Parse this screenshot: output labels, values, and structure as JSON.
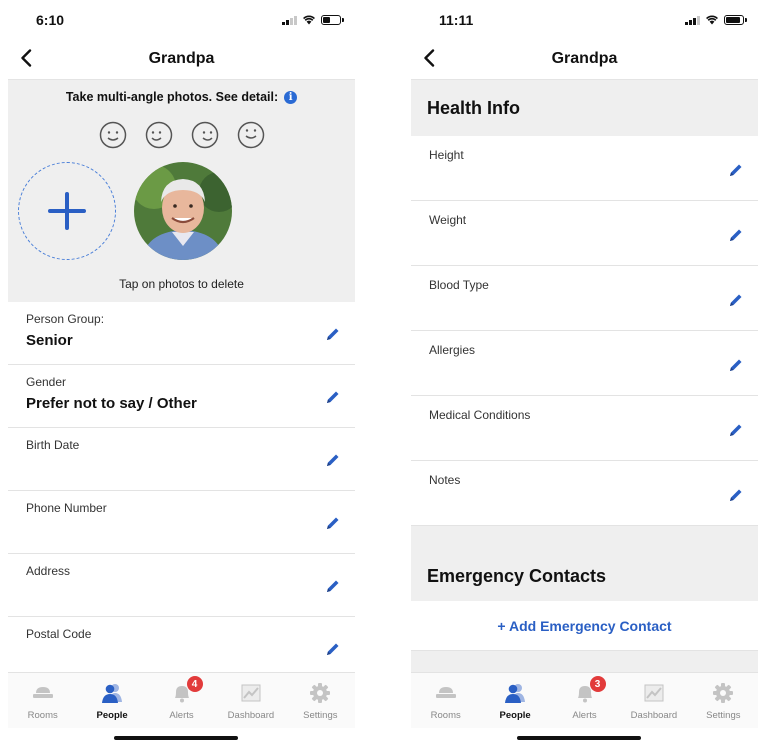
{
  "colors": {
    "accent": "#2a5fc4",
    "section_bg": "#efefef",
    "badge": "#e23b3b",
    "icon_inactive": "#b8b8b8"
  },
  "left": {
    "status": {
      "time": "6:10"
    },
    "nav": {
      "title": "Grandpa",
      "back_icon": "chevron-left-icon"
    },
    "photos": {
      "hint": "Take multi-angle photos. See detail:",
      "info_icon_glyph": "i",
      "caption": "Tap on photos to delete",
      "add_icon": "plus-icon"
    },
    "fields": [
      {
        "label": "Person Group:",
        "value": "Senior"
      },
      {
        "label": "Gender",
        "value": "Prefer not to say / Other"
      },
      {
        "label": "Birth Date",
        "value": ""
      },
      {
        "label": "Phone Number",
        "value": ""
      },
      {
        "label": "Address",
        "value": ""
      },
      {
        "label": "Postal Code",
        "value": ""
      }
    ],
    "alerts_badge": "4"
  },
  "right": {
    "status": {
      "time": "11:11"
    },
    "nav": {
      "title": "Grandpa",
      "back_icon": "chevron-left-icon"
    },
    "health_header": "Health Info",
    "health_fields": [
      {
        "label": "Height"
      },
      {
        "label": "Weight"
      },
      {
        "label": "Blood Type"
      },
      {
        "label": "Allergies"
      },
      {
        "label": "Medical Conditions"
      },
      {
        "label": "Notes"
      }
    ],
    "emergency_header": "Emergency Contacts",
    "add_contact": "+ Add Emergency Contact",
    "alerts_badge": "3"
  },
  "tabs": [
    {
      "label": "Rooms",
      "icon": "rooms-icon"
    },
    {
      "label": "People",
      "icon": "people-icon",
      "active": true
    },
    {
      "label": "Alerts",
      "icon": "bell-icon"
    },
    {
      "label": "Dashboard",
      "icon": "chart-icon"
    },
    {
      "label": "Settings",
      "icon": "gear-icon"
    }
  ]
}
